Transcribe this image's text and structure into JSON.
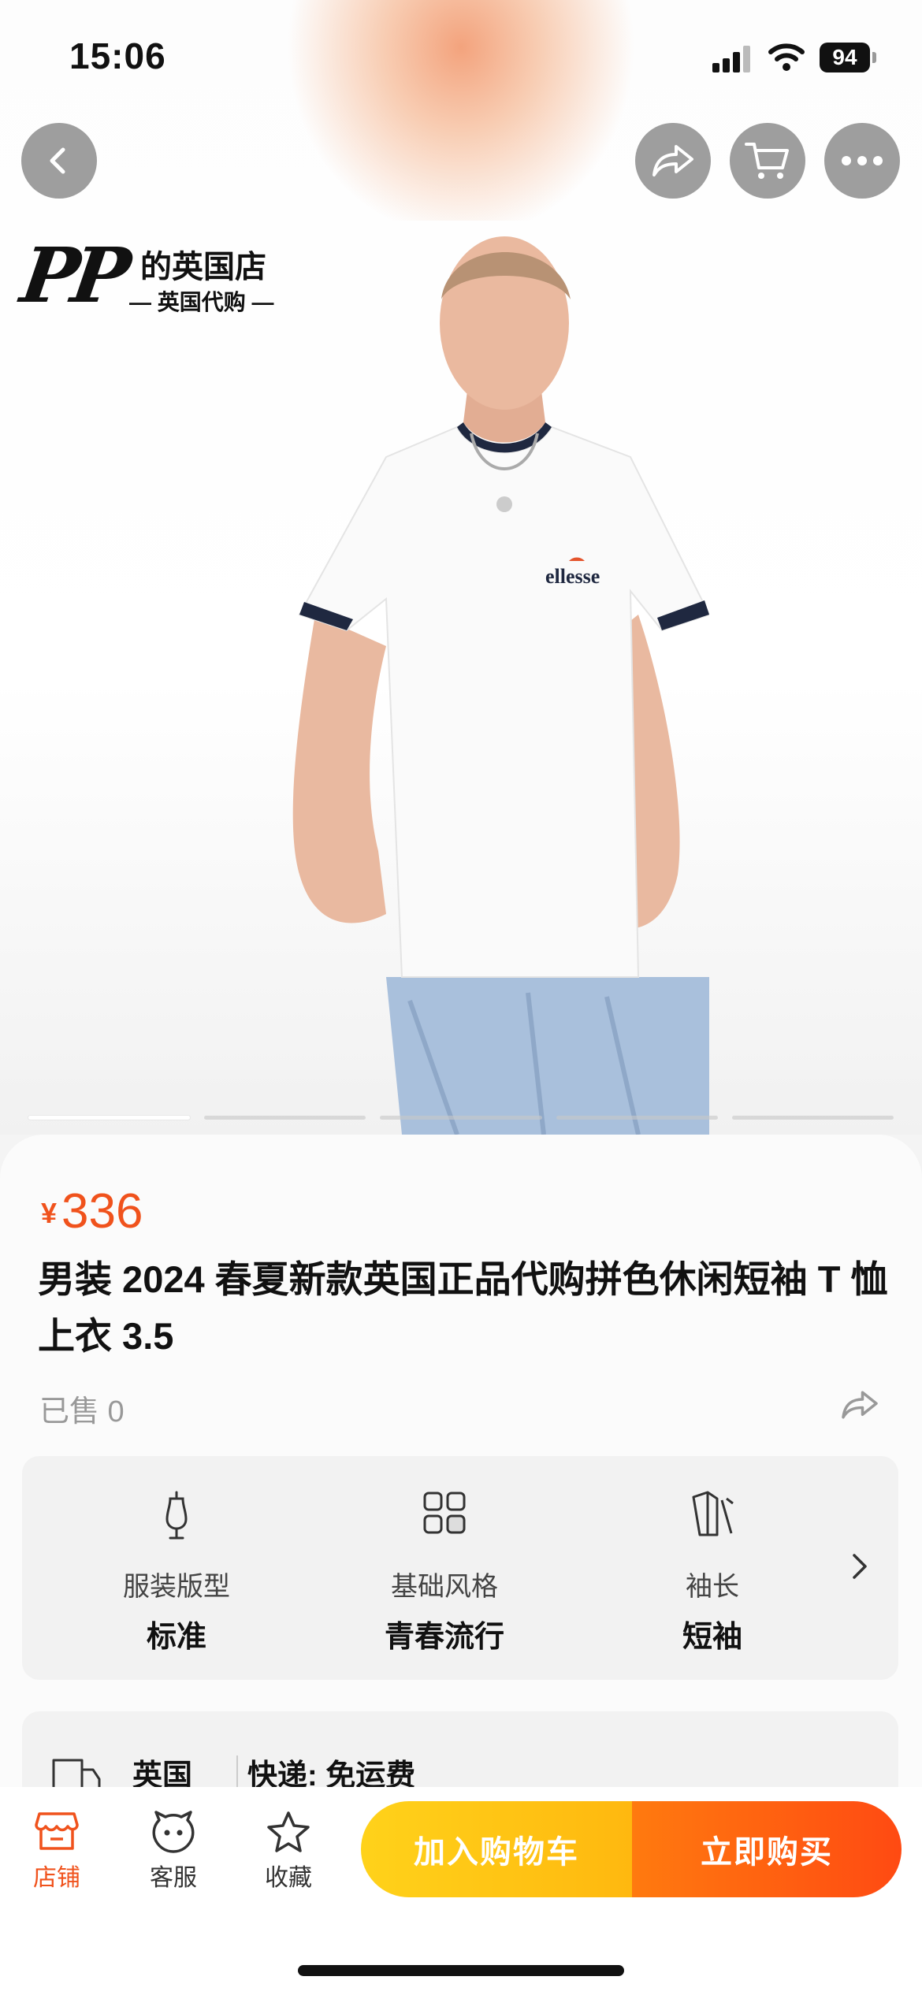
{
  "status_bar": {
    "time": "15:06",
    "battery": "94"
  },
  "store": {
    "logo_mark": "PP",
    "name": "的英国店",
    "subtitle": "— 英国代购 —"
  },
  "product": {
    "currency": "¥",
    "price": "336",
    "title": "男装 2024 春夏新款英国正品代购拼色休闲短袖 T 恤上衣 3.5",
    "sold": "已售 0",
    "image_count": 5,
    "current_image": 1
  },
  "attributes": [
    {
      "icon": "dress-form-icon",
      "label": "服装版型",
      "value": "标准"
    },
    {
      "icon": "grid-style-icon",
      "label": "基础风格",
      "value": "青春流行"
    },
    {
      "icon": "sleeve-icon",
      "label": "袖长",
      "value": "短袖"
    }
  ],
  "shipping": {
    "origin": "英国",
    "express": "快递: 免运费"
  },
  "bottom_bar": {
    "tabs": [
      {
        "icon": "store-icon",
        "label": "店铺"
      },
      {
        "icon": "service-icon",
        "label": "客服"
      },
      {
        "icon": "star-icon",
        "label": "收藏"
      }
    ],
    "add_to_cart": "加入购物车",
    "buy_now": "立即购买"
  },
  "colors": {
    "accent": "#f0521c",
    "cart_button": "#ffc414",
    "buy_button": "#ff5a10"
  }
}
